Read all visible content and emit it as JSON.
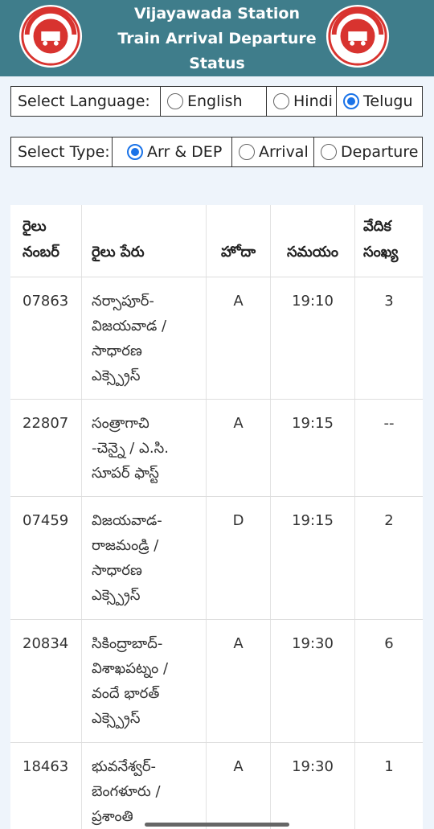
{
  "header": {
    "title_line1": "Vijayawada Station",
    "title_line2": "Train Arrival Departure",
    "title_line3": "Status",
    "logo_text": "INDIAN RAILWAYS",
    "logo_icon": "indian-railways-logo",
    "bg_color": "#3f7d8b"
  },
  "language_selector": {
    "label": "Select Language:",
    "options": [
      {
        "label": "English",
        "checked": false
      },
      {
        "label": "Hindi",
        "checked": false
      },
      {
        "label": "Telugu",
        "checked": true
      }
    ]
  },
  "type_selector": {
    "label": "Select Type:",
    "options": [
      {
        "label": "Arr & DEP",
        "checked": true
      },
      {
        "label": "Arrival",
        "checked": false
      },
      {
        "label": "Departure",
        "checked": false
      }
    ]
  },
  "table": {
    "headers": {
      "train_number": "రైలు\nనంబర్",
      "train_name": "రైలు పేరు",
      "position": "హోదా",
      "time": "సమయం",
      "platform": "వేదిక\nసంఖ్య"
    },
    "rows": [
      {
        "number": "07863",
        "name": "నర్సాపూర్-\nవిజయవాడ /\nసాధారణ\nఎక్స్ప్రెస్",
        "position": "A",
        "time": "19:10",
        "platform": "3"
      },
      {
        "number": "22807",
        "name": "సంత్రాగాచి\n-చెన్నై / ఎ.సి.\nసూపర్ ఫాస్ట్",
        "position": "A",
        "time": "19:15",
        "platform": "--"
      },
      {
        "number": "07459",
        "name": "విజయవాడ-\nరాజమండ్రి /\nసాధారణ\nఎక్స్ప్రెస్",
        "position": "D",
        "time": "19:15",
        "platform": "2"
      },
      {
        "number": "20834",
        "name": "సికింద్రాబాద్-\nవిశాఖపట్నం /\nవందే భారత్\nఎక్స్ప్రెస్",
        "position": "A",
        "time": "19:30",
        "platform": "6"
      },
      {
        "number": "18463",
        "name": "భువనేశ్వర్-\nబెంగళూరు /\nప్రశాంతి\nఎక్స్ప్రెస్",
        "position": "A",
        "time": "19:30",
        "platform": "1"
      }
    ]
  }
}
